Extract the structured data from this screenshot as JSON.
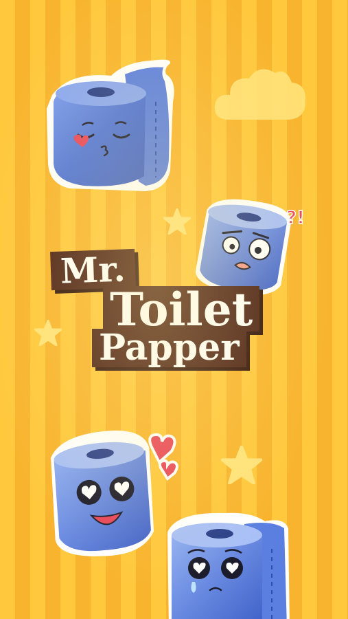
{
  "app": {
    "logo": {
      "line1": "Mr.",
      "line2": "Toilet",
      "line3": "Papper"
    },
    "colors": {
      "background_stripe_light": "#FFC83D",
      "background_stripe_dark": "#F8B42E",
      "logo_box": "#4A1F16",
      "sticker_blue": "#4F74D9",
      "heart_red": "#E8465A"
    },
    "stickers": [
      {
        "name": "kissing-face",
        "icon": "toilet-roll-kiss-icon"
      },
      {
        "name": "shocked-face",
        "icon": "toilet-roll-shocked-icon",
        "exclaim": "?!"
      },
      {
        "name": "in-love-face",
        "icon": "toilet-roll-love-icon"
      },
      {
        "name": "teary-face",
        "icon": "toilet-roll-teary-icon"
      }
    ],
    "decorations": [
      "cloud-icon",
      "star-icon"
    ]
  }
}
